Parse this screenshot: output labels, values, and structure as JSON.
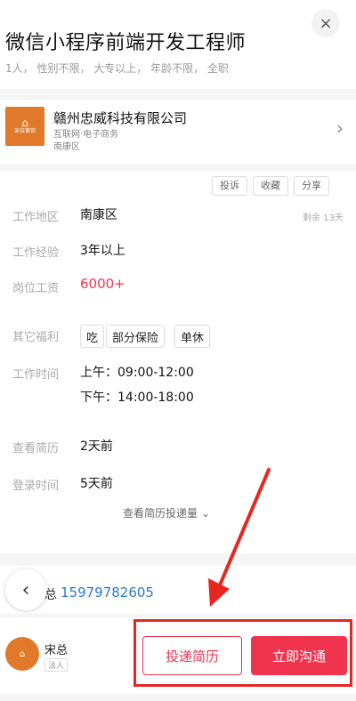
{
  "header": {
    "title": "微信小程序前端开发工程师",
    "subtitle": "1人， 性别不限， 大专以上， 年龄不限， 全职",
    "close_icon": "×"
  },
  "company": {
    "logo_text": "宋拉茶馆",
    "name": "赣州忠威科技有限公司",
    "industry": "互联网·电子商务",
    "district": "南康区",
    "chevron": "›"
  },
  "actions": [
    "投诉",
    "收藏",
    "分享"
  ],
  "details": {
    "location_label": "工作地区",
    "location_value": "南康区",
    "remaining": "剩余 13天",
    "experience_label": "工作经验",
    "experience_value": "3年以上",
    "salary_label": "岗位工资",
    "salary_value": "6000+",
    "benefits_label": "其它福利",
    "benefits": [
      "吃",
      "部分保险",
      "单休"
    ],
    "hours_label": "工作时间",
    "hours_am": "上午：09:00-12:00",
    "hours_pm": "下午：14:00-18:00",
    "view_resume_label": "查看简历",
    "view_resume_value": "2天前",
    "login_label": "登录时间",
    "login_value": "5天前",
    "more_link": "查看简历投递量 ⌄"
  },
  "contact": {
    "back_icon": "‹",
    "label": "总",
    "phone": "15979782605"
  },
  "recruiter": {
    "avatar_text": "宋拉茶馆",
    "name": "宋总",
    "tag": "法人"
  },
  "buttons": {
    "apply": "投递简历",
    "chat": "立即沟通"
  },
  "colors": {
    "accent": "#f0344f",
    "highlight": "#e8261f",
    "logo": "#e07a2a"
  }
}
